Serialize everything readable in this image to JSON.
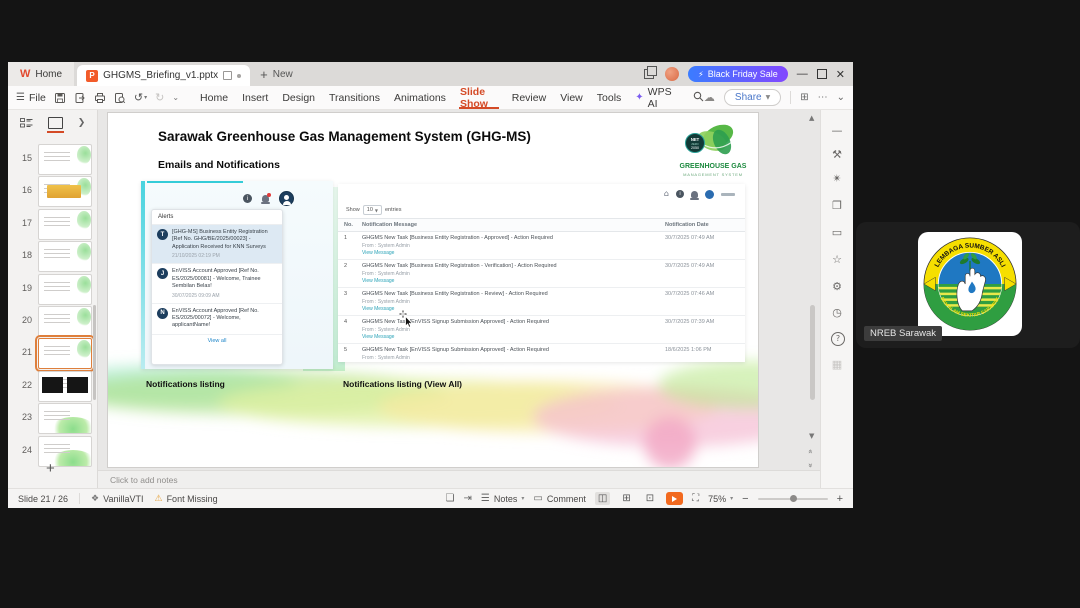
{
  "titlebar": {
    "home_tab": "Home",
    "doc_tab": "GHGMS_Briefing_v1.pptx",
    "new_label": "New",
    "sale_label": "Black Friday Sale"
  },
  "toolbar": {
    "file_label": "File",
    "menus": [
      "Home",
      "Insert",
      "Design",
      "Transitions",
      "Animations",
      "Slide Show",
      "Review",
      "View",
      "Tools"
    ],
    "active_menu": "Slide Show",
    "wps_ai_label": "WPS AI",
    "share_label": "Share"
  },
  "thumb_panel": {
    "numbers": [
      15,
      16,
      17,
      18,
      19,
      20,
      21,
      22,
      23,
      24
    ],
    "selected": 21
  },
  "slide": {
    "title": "Sarawak Greenhouse Gas Management System (GHG-MS)",
    "subtitle": "Emails and Notifications",
    "logo": {
      "badge_line1": "NET",
      "badge_line2": "ZERO",
      "badge_line3": "2050",
      "name_line1": "GREENHOUSE GAS",
      "name_line2": "MANAGEMENT SYSTEM"
    },
    "alerts": {
      "header": "Alerts",
      "view_all": "View all",
      "items": [
        {
          "initial": "T",
          "text": "[GHG-MS] Business Entity Registration [Ref No. GHG/BE/2025/00023] - Application Received for KNN Surveys",
          "time": "21/10/2025 02:19 PM",
          "highlighted": true
        },
        {
          "initial": "J",
          "text": "EnVISS Account Approved [Ref No. ES/2025/00081] - Welcome, Trainee Sembilan Belas!",
          "time": "30/07/2025 09:09 AM",
          "highlighted": false
        },
        {
          "initial": "N",
          "text": "EnVISS Account Approved [Ref No. ES/2025/00072] - Welcome, applicantName!",
          "time": "",
          "highlighted": false
        }
      ]
    },
    "table": {
      "show_label": "Show",
      "show_value": "10",
      "entries_label": "entries",
      "columns": [
        "No.",
        "Notification Message",
        "Notification Date"
      ],
      "rows": [
        {
          "no": "1",
          "message": "GHGMS New Task [Business Entity Registration - Approved] - Action Required",
          "from": "From : System Admin",
          "link": "View Message",
          "date": "30/7/2025 07:49 AM"
        },
        {
          "no": "2",
          "message": "GHGMS New Task [Business Entity Registration - Verification] - Action Required",
          "from": "From : System Admin",
          "link": "View Message",
          "date": "30/7/2025 07:49 AM"
        },
        {
          "no": "3",
          "message": "GHGMS New Task [Business Entity Registration - Review] - Action Required",
          "from": "From : System Admin",
          "link": "View Message",
          "date": "30/7/2025 07:46 AM"
        },
        {
          "no": "4",
          "message": "GHGMS New Task [EnVISS Signup Submission Approved] - Action Required",
          "from": "From : System Admin",
          "link": "View Message",
          "date": "30/7/2025 07:39 AM"
        },
        {
          "no": "5",
          "message": "GHGMS New Task [EnVISS Signup Submission Approved] - Action Required",
          "from": "From : System Admin",
          "link": "View Message",
          "date": "18/6/2025 1:06 PM"
        }
      ]
    },
    "caption_left": "Notifications listing",
    "caption_right": "Notifications listing (View All)"
  },
  "notes_placeholder": "Click to add notes",
  "statusbar": {
    "slide_indicator": "Slide 21 / 26",
    "theme_name": "VanillaVTI",
    "font_warning": "Font Missing",
    "notes_label": "Notes",
    "comment_label": "Comment",
    "zoom_level": "75%"
  },
  "icons": {
    "sidebar": [
      "collapse",
      "edit-tools",
      "ai-beautify",
      "shapes",
      "comment",
      "star",
      "settings",
      "history",
      "help",
      "apps"
    ]
  },
  "meeting": {
    "participant_name": "NREB Sarawak",
    "logo_arc_top": "LEMBAGA SUMBER ASLI",
    "logo_arc_bottom": "DAN ALAM SEKITAR SARAWAK"
  },
  "colors": {
    "wps_accent": "#d44a26",
    "sale_gradient_start": "#3b7cff",
    "sale_gradient_end": "#8247ff",
    "link_teal": "#2aa3b8",
    "alert_navy": "#1d3e5e"
  }
}
